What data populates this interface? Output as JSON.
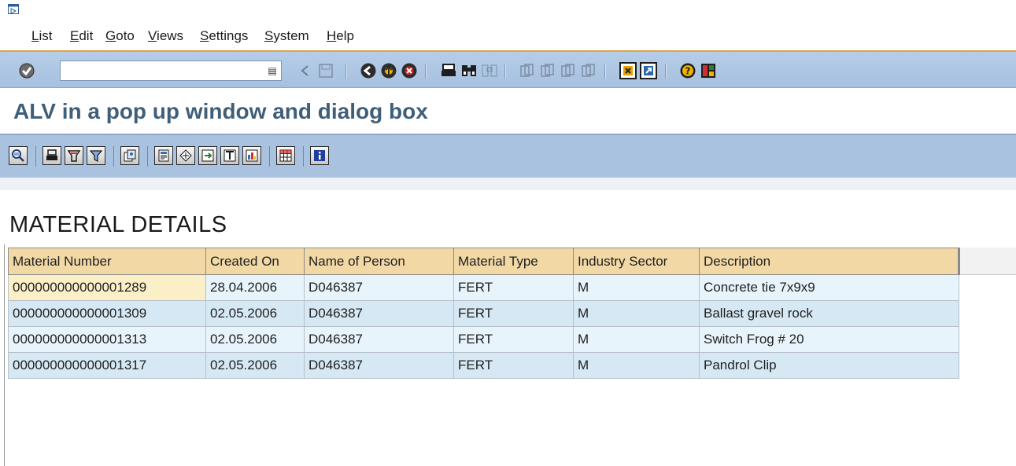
{
  "menu": {
    "items": [
      "List",
      "Edit",
      "Goto",
      "Views",
      "Settings",
      "System",
      "Help"
    ]
  },
  "toolbar": {
    "command_value": "",
    "icons": [
      "enter-icon",
      "back-arrow-icon",
      "save-icon",
      "back-icon",
      "exit-icon",
      "cancel-icon",
      "print-icon",
      "find-icon",
      "find-next-icon",
      "first-page-icon",
      "previous-page-icon",
      "next-page-icon",
      "last-page-icon",
      "create-session-icon",
      "create-shortcut-icon",
      "help-icon",
      "customize-layout-icon"
    ]
  },
  "title": "ALV in a pop up window and dialog box",
  "app_toolbar": {
    "icons": [
      "details-icon",
      "sort-ascending-icon",
      "sort-descending-icon",
      "filter-icon",
      "sum-icon",
      "print-preview-icon",
      "abc-analysis-icon",
      "export-icon",
      "word-processing-icon",
      "local-file-icon",
      "change-layout-icon",
      "information-icon"
    ]
  },
  "list": {
    "heading": "MATERIAL DETAILS",
    "columns": [
      "Material Number",
      "Created On",
      "Name of Person",
      "Material Type",
      "Industry Sector",
      "Description"
    ],
    "rows": [
      [
        "000000000000001289",
        "28.04.2006",
        "D046387",
        "FERT",
        "M",
        "Concrete tie 7x9x9"
      ],
      [
        "000000000000001309",
        "02.05.2006",
        "D046387",
        "FERT",
        "M",
        "Ballast gravel rock"
      ],
      [
        "000000000000001313",
        "02.05.2006",
        "D046387",
        "FERT",
        "M",
        "Switch Frog # 20"
      ],
      [
        "000000000000001317",
        "02.05.2006",
        "D046387",
        "FERT",
        "M",
        "Pandrol Clip"
      ]
    ]
  },
  "colors": {
    "header_bg": "#f2d8a5",
    "row_odd": "#e8f4fb",
    "row_even": "#d6e8f3",
    "toolbar_bg": "#a9c2df",
    "title_color": "#3f5f79",
    "accent_orange": "#e4a042"
  }
}
